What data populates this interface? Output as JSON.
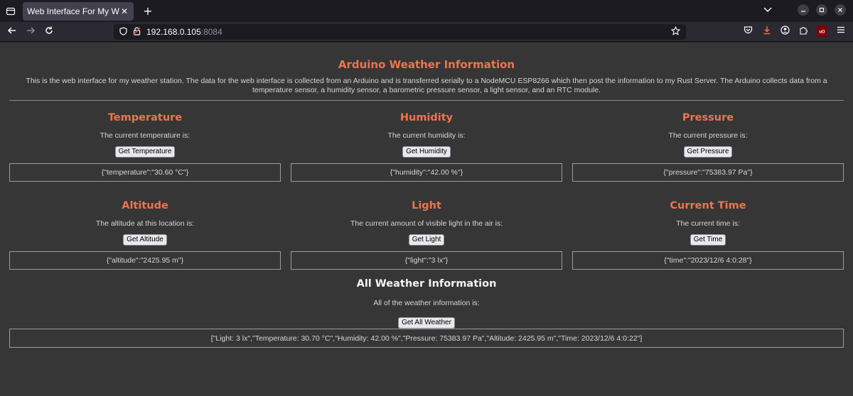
{
  "browser": {
    "tab_title": "Web Interface For My Weath",
    "tab_close": "✕",
    "new_tab": "+",
    "url_host": "192.168.0.105",
    "url_port": ":8084"
  },
  "page": {
    "title": "Arduino Weather Information",
    "intro": "This is the web interface for my weather station. The data for the web interface is collected from an Arduino and is transferred serially to a NodeMCU ESP8266 which then post the information to my Rust Server. The Arduino collects data from a temperature sensor, a humidity sensor, a barometric pressure sensor, a light sensor, and an RTC module.",
    "sections": [
      {
        "heading": "Temperature",
        "desc": "The current temperature is:",
        "button": "Get Temperature",
        "output": "{\"temperature\":\"30.60 °C\"}"
      },
      {
        "heading": "Humidity",
        "desc": "The current humidity is:",
        "button": "Get Humidity",
        "output": "{\"humidity\":\"42.00 %\"}"
      },
      {
        "heading": "Pressure",
        "desc": "The current pressure is:",
        "button": "Get Pressure",
        "output": "{\"pressure\":\"75383.97 Pa\"}"
      },
      {
        "heading": "Altitude",
        "desc": "The altitude at this location is:",
        "button": "Get Altitude",
        "output": "{\"altitude\":\"2425.95 m\"}"
      },
      {
        "heading": "Light",
        "desc": "The current amount of visible light in the air is:",
        "button": "Get Light",
        "output": "{\"light\":\"3 lx\"}"
      },
      {
        "heading": "Current Time",
        "desc": "The current time is:",
        "button": "Get Time",
        "output": "{\"time\":\"2023/12/6 4:0:28\"}"
      }
    ],
    "all": {
      "heading": "All Weather Information",
      "desc": "All of the weather information is:",
      "button": "Get All Weather",
      "output": "[\"Light: 3 lx\",\"Temperature: 30.70 °C\",\"Humidity: 42.00 %\",\"Pressure: 75383.97 Pa\",\"Altitude: 2425.95 m\",\"Time: 2023/12/6 4:0:22\"]"
    }
  },
  "colors": {
    "heading_accent": "#f0744b",
    "page_background": "#363636"
  }
}
